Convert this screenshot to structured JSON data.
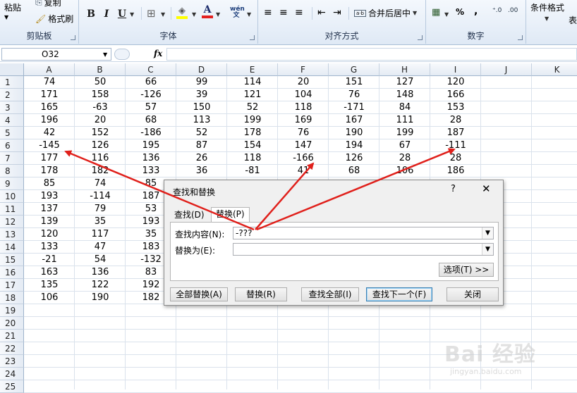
{
  "ribbon": {
    "clipboard": {
      "paste_label": "粘贴",
      "copy_label": "复制",
      "format_painter_label": "格式刷",
      "group_label": "剪贴板"
    },
    "font": {
      "bold": "B",
      "italic": "I",
      "underline": "U",
      "group_label": "字体",
      "phonetic": "wén 文"
    },
    "alignment": {
      "merge_label": "合并后居中",
      "group_label": "对齐方式"
    },
    "number": {
      "percent": "%",
      "comma": ",",
      "group_label": "数字"
    },
    "styles": {
      "conditional_label": "条件格式",
      "table_label": "表"
    }
  },
  "formula_bar": {
    "name_box": "O32",
    "fx": "fx",
    "formula": ""
  },
  "grid": {
    "columns": [
      "A",
      "B",
      "C",
      "D",
      "E",
      "F",
      "G",
      "H",
      "I",
      "J",
      "K"
    ],
    "rows": [
      "1",
      "2",
      "3",
      "4",
      "5",
      "6",
      "7",
      "8",
      "9",
      "10",
      "11",
      "12",
      "13",
      "14",
      "15",
      "16",
      "17",
      "18",
      "19",
      "20",
      "21",
      "22",
      "23",
      "24",
      "25"
    ],
    "cells": [
      [
        "74",
        "50",
        "66",
        "99",
        "114",
        "20",
        "151",
        "127",
        "120"
      ],
      [
        "171",
        "158",
        "-126",
        "39",
        "121",
        "104",
        "76",
        "148",
        "166"
      ],
      [
        "165",
        "-63",
        "57",
        "150",
        "52",
        "118",
        "-171",
        "84",
        "153"
      ],
      [
        "196",
        "20",
        "68",
        "113",
        "199",
        "169",
        "167",
        "111",
        "28"
      ],
      [
        "42",
        "152",
        "-186",
        "52",
        "178",
        "76",
        "190",
        "199",
        "187"
      ],
      [
        "-145",
        "126",
        "195",
        "87",
        "154",
        "147",
        "194",
        "67",
        "-111"
      ],
      [
        "177",
        "116",
        "136",
        "26",
        "118",
        "-166",
        "126",
        "28",
        "28"
      ],
      [
        "178",
        "182",
        "133",
        "36",
        "-81",
        "41",
        "68",
        "106",
        "186"
      ],
      [
        "85",
        "74",
        "85",
        "",
        "",
        "",
        "",
        "",
        ""
      ],
      [
        "193",
        "-114",
        "187",
        "",
        "",
        "",
        "",
        "",
        ""
      ],
      [
        "137",
        "79",
        "53",
        "",
        "",
        "",
        "",
        "",
        ""
      ],
      [
        "139",
        "35",
        "193",
        "",
        "",
        "",
        "",
        "",
        ""
      ],
      [
        "120",
        "117",
        "35",
        "",
        "",
        "",
        "",
        "",
        ""
      ],
      [
        "133",
        "47",
        "183",
        "",
        "",
        "",
        "",
        "",
        ""
      ],
      [
        "-21",
        "54",
        "-132",
        "",
        "",
        "",
        "",
        "",
        ""
      ],
      [
        "163",
        "136",
        "83",
        "",
        "",
        "",
        "",
        "",
        ""
      ],
      [
        "135",
        "122",
        "192",
        "",
        "",
        "",
        "",
        "",
        ""
      ],
      [
        "106",
        "190",
        "182",
        "",
        "",
        "",
        "",
        "",
        ""
      ]
    ]
  },
  "dialog": {
    "title": "查找和替换",
    "help": "?",
    "close": "✕",
    "tab_find": "查找(D)",
    "tab_replace": "替换(P)",
    "find_label": "查找内容(N):",
    "find_value": "-???",
    "replace_label": "替换为(E):",
    "replace_value": "",
    "options_button": "选项(T) >>",
    "buttons": {
      "replace_all": "全部替换(A)",
      "replace": "替换(R)",
      "find_all": "查找全部(I)",
      "find_next": "查找下一个(F)",
      "close": "关闭"
    }
  },
  "watermark": {
    "text": "Bai 经验",
    "sub": "jingyan.baidu.com"
  },
  "colors": {
    "arrow": "#e0201b",
    "ribbon_bg": "#dfe9f5",
    "header_bg": "#e4ebf4"
  }
}
